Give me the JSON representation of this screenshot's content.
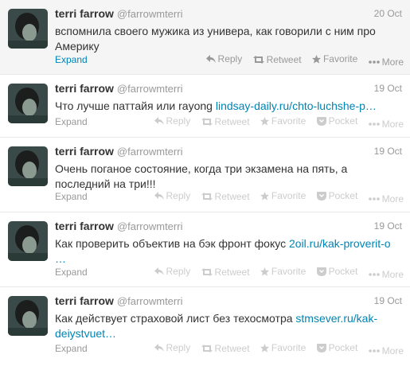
{
  "tweets": [
    {
      "fullname": "terri farrow",
      "username": "@farrowmterri",
      "time": "20 Oct",
      "text": "вспомнила своего мужика из универа, как говорили с ним про Америку",
      "link": "",
      "link_cont": "",
      "expand": "Expand",
      "actions": {
        "reply": "Reply",
        "retweet": "Retweet",
        "favorite": "Favorite",
        "pocket": "",
        "more": "More"
      }
    },
    {
      "fullname": "terri farrow",
      "username": "@farrowmterri",
      "time": "19 Oct",
      "text": "Что лучше паттайя или rayong ",
      "link": "lindsay-daily.ru/chto-luchshe-p…",
      "link_cont": "",
      "expand": "Expand",
      "actions": {
        "reply": "Reply",
        "retweet": "Retweet",
        "favorite": "Favorite",
        "pocket": "Pocket",
        "more": "More"
      }
    },
    {
      "fullname": "terri farrow",
      "username": "@farrowmterri",
      "time": "19 Oct",
      "text": "Очень поганое состояние, когда три экзамена на пять, а последний на три!!!",
      "link": "",
      "link_cont": "",
      "expand": "Expand",
      "actions": {
        "reply": "Reply",
        "retweet": "Retweet",
        "favorite": "Favorite",
        "pocket": "Pocket",
        "more": "More"
      }
    },
    {
      "fullname": "terri farrow",
      "username": "@farrowmterri",
      "time": "19 Oct",
      "text": "Как проверить объектив на бэк фронт фокус ",
      "link": "2oil.ru/kak-proverit-o",
      "link_cont": "…",
      "expand": "Expand",
      "actions": {
        "reply": "Reply",
        "retweet": "Retweet",
        "favorite": "Favorite",
        "pocket": "Pocket",
        "more": "More"
      }
    },
    {
      "fullname": "terri farrow",
      "username": "@farrowmterri",
      "time": "19 Oct",
      "text": "Как действует страховой лист без техосмотра ",
      "link": "stmsever.ru/kak-",
      "link_cont": "deiystvuet…",
      "expand": "Expand",
      "actions": {
        "reply": "Reply",
        "retweet": "Retweet",
        "favorite": "Favorite",
        "pocket": "Pocket",
        "more": "More"
      }
    }
  ]
}
